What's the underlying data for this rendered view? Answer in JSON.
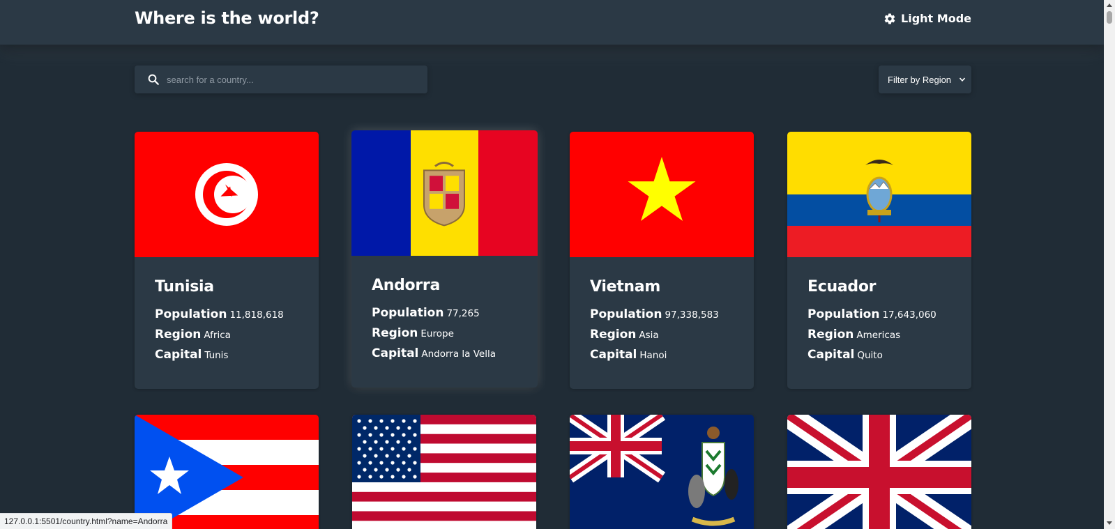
{
  "header": {
    "title": "Where is the world?",
    "mode_toggle_label": "Light Mode",
    "mode_icon": "gear-icon"
  },
  "search": {
    "placeholder": "search for a country...",
    "value": "",
    "icon": "search-icon"
  },
  "filter": {
    "label": "Filter by Region",
    "icon": "chevron-down-icon"
  },
  "labels": {
    "population": "Population",
    "region": "Region",
    "capital": "Capital"
  },
  "cards": [
    {
      "name": "Tunisia",
      "population": "11,818,618",
      "region": "Africa",
      "capital": "Tunis",
      "flag": "tunisia-flag"
    },
    {
      "name": "Andorra",
      "population": "77,265",
      "region": "Europe",
      "capital": "Andorra la Vella",
      "flag": "andorra-flag"
    },
    {
      "name": "Vietnam",
      "population": "97,338,583",
      "region": "Asia",
      "capital": "Hanoi",
      "flag": "vietnam-flag"
    },
    {
      "name": "Ecuador",
      "population": "17,643,060",
      "region": "Americas",
      "capital": "Quito",
      "flag": "ecuador-flag"
    },
    {
      "name": "",
      "population": "",
      "region": "",
      "capital": "",
      "flag": "puerto-rico-flag"
    },
    {
      "name": "",
      "population": "",
      "region": "",
      "capital": "",
      "flag": "united-states-flag"
    },
    {
      "name": "",
      "population": "",
      "region": "",
      "capital": "",
      "flag": "south-georgia-flag"
    },
    {
      "name": "",
      "population": "",
      "region": "",
      "capital": "",
      "flag": "united-kingdom-flag"
    }
  ],
  "status_bar": {
    "url": "127.0.0.1:5501/country.html?name=Andorra"
  },
  "colors": {
    "background": "#202c36",
    "surface": "#2b3945",
    "text": "#ffffff"
  }
}
